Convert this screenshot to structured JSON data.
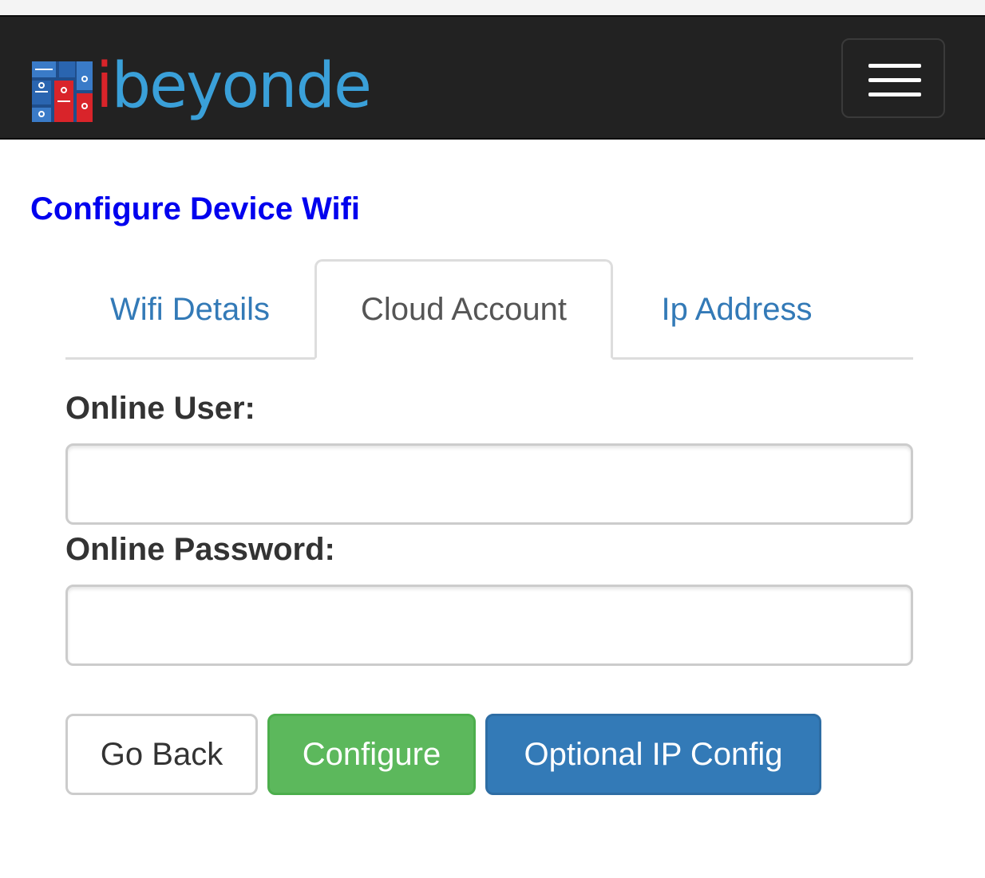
{
  "brand": {
    "logo_icon": "circuit-board-logo-icon",
    "logo_letter": "i",
    "logo_rest": "beyonde",
    "colors": {
      "red": "#d9242a",
      "blue": "#3aa0d9"
    }
  },
  "navbar": {
    "menu_icon": "hamburger-menu-icon",
    "background": "#222222"
  },
  "page": {
    "title": "Configure Device Wifi"
  },
  "tabs": [
    {
      "label": "Wifi Details",
      "active": false
    },
    {
      "label": "Cloud Account",
      "active": true
    },
    {
      "label": "Ip Address",
      "active": false
    }
  ],
  "form": {
    "user_label": "Online User:",
    "user_value": "",
    "password_label": "Online Password:",
    "password_value": ""
  },
  "buttons": {
    "back": "Go Back",
    "configure": "Configure",
    "ip_config": "Optional IP Config"
  },
  "colors": {
    "link": "#337ab7",
    "title": "#0000ee",
    "success": "#5cb85c",
    "primary": "#337ab7"
  }
}
